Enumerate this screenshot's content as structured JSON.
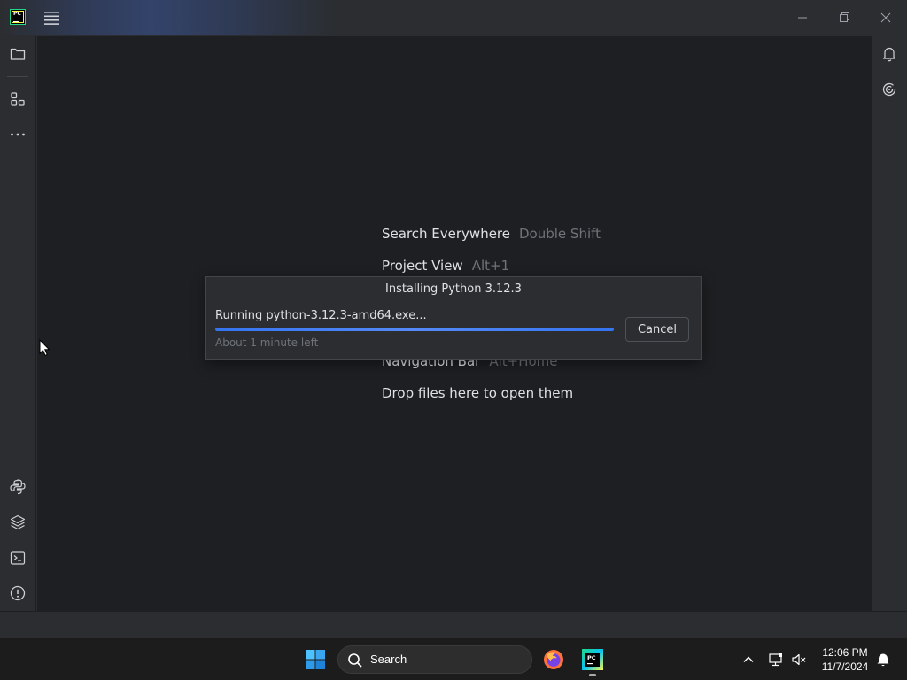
{
  "titlebar": {
    "logo_text": "PC"
  },
  "editor": {
    "hints": [
      {
        "label": "Search Everywhere",
        "shortcut": "Double Shift"
      },
      {
        "label": "Project View",
        "shortcut": "Alt+1"
      },
      {
        "label": "Navigation Bar",
        "shortcut": "Alt+Home"
      },
      {
        "label": "Drop files here to open them",
        "shortcut": ""
      }
    ]
  },
  "dialog": {
    "title": "Installing Python 3.12.3",
    "status": "Running python-3.12.3-amd64.exe...",
    "eta": "About 1 minute left",
    "progress_percent": 100,
    "cancel_label": "Cancel"
  },
  "taskbar": {
    "search_label": "Search",
    "time": "12:06 PM",
    "date": "11/7/2024",
    "pycharm_logo_text": "PC"
  },
  "colors": {
    "accent": "#3574f0",
    "editor_bg": "#1e1f22",
    "panel_bg": "#2b2d30",
    "muted_text": "#6f737a"
  }
}
